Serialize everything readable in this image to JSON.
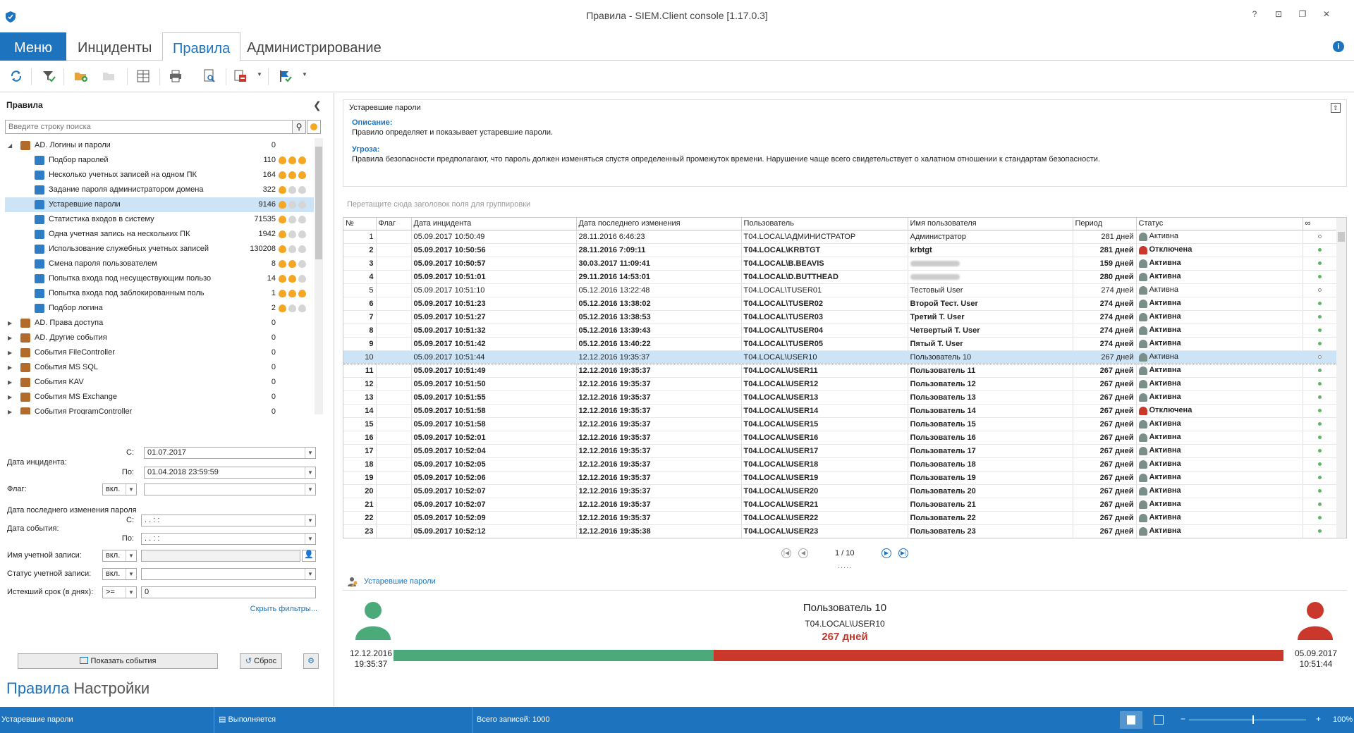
{
  "window": {
    "title": "Правила - SIEM.Client console [1.17.0.3]",
    "controls": [
      "?",
      "⊡",
      "❐",
      "✕"
    ]
  },
  "menu": {
    "tabs": [
      "Меню",
      "Инциденты",
      "Правила",
      "Администрирование"
    ],
    "active": 2,
    "info": "i"
  },
  "colors": {
    "accent": "#1e73be",
    "selection": "#cde4f7",
    "active_green": "#4aaa79",
    "expired_red": "#c9382a"
  },
  "left": {
    "title": "Правила",
    "search_placeholder": "Введите строку поиска",
    "tree": [
      {
        "label": "AD. Логины и пароли",
        "count": "0",
        "level": 0,
        "expanded": true,
        "icon": "user-key-icon"
      },
      {
        "label": "Подбор паролей",
        "count": "110",
        "level": 1,
        "fire": 3,
        "icon": "key-grid-icon"
      },
      {
        "label": "Несколько учетных записей на одном ПК",
        "count": "164",
        "level": 1,
        "fire": 3,
        "icon": "monitor-icon"
      },
      {
        "label": "Задание пароля администратором домена",
        "count": "322",
        "level": 1,
        "fire": 1,
        "icon": "admin-icon"
      },
      {
        "label": "Устаревшие пароли",
        "count": "9146",
        "level": 1,
        "fire": 1,
        "icon": "key-user-icon",
        "selected": true
      },
      {
        "label": "Статистика входов в систему",
        "count": "71535",
        "level": 1,
        "fire": 1,
        "icon": "login-icon"
      },
      {
        "label": "Одна учетная запись на нескольких ПК",
        "count": "1942",
        "level": 1,
        "fire": 1,
        "icon": "multi-pc-icon"
      },
      {
        "label": "Использование служебных учетных записей",
        "count": "130208",
        "level": 1,
        "fire": 1,
        "icon": "service-icon"
      },
      {
        "label": "Смена пароля пользователем",
        "count": "8",
        "level": 1,
        "fire": 2,
        "icon": "password-change-icon"
      },
      {
        "label": "Попытка входа под несуществующим пользо",
        "count": "14",
        "level": 1,
        "fire": 2,
        "icon": "sun-user-icon"
      },
      {
        "label": "Попытка входа под заблокированным поль",
        "count": "1",
        "level": 1,
        "fire": 3,
        "icon": "blocked-user-icon"
      },
      {
        "label": "Подбор логина",
        "count": "2",
        "level": 1,
        "fire": 1,
        "icon": "login-guess-icon"
      },
      {
        "label": "AD. Права доступа",
        "count": "0",
        "level": 0,
        "icon": "access-icon"
      },
      {
        "label": "AD. Другие события",
        "count": "0",
        "level": 0,
        "icon": "ad-events-icon"
      },
      {
        "label": "События FileController",
        "count": "0",
        "level": 0,
        "icon": "file-icon"
      },
      {
        "label": "События MS SQL",
        "count": "0",
        "level": 0,
        "icon": "sql-icon"
      },
      {
        "label": "События KAV",
        "count": "0",
        "level": 0,
        "icon": "kav-icon"
      },
      {
        "label": "События MS Exchange",
        "count": "0",
        "level": 0,
        "icon": "exchange-icon"
      },
      {
        "label": "События ProgramController",
        "count": "0",
        "level": 0,
        "icon": "program-icon"
      }
    ],
    "filters": {
      "incident_date": "Дата инцидента:",
      "from": "С:",
      "to": "По:",
      "from_value": "01.07.2017",
      "to_value": "01.04.2018 23:59:59",
      "flag": "Флаг:",
      "flag_mode": "вкл.",
      "flag_value": "",
      "last_change": "Дата последнего изменения пароля",
      "event_date": "Дата события:",
      "event_from": " .  .     :  :",
      "event_to": " .  .     :  :",
      "account_name": "Имя учетной записи:",
      "account_mode": "вкл.",
      "account_value": "",
      "account_status": "Статус учетной записи:",
      "status_mode": "вкл.",
      "status_value": "",
      "expired": "Истекший срок (в днях):",
      "expired_op": ">=",
      "expired_value": "0",
      "hide": "Скрыть фильтры..."
    },
    "show_events": "Показать события",
    "reset": "Сброс",
    "bottom_tabs": [
      "Правила",
      "Настройки"
    ]
  },
  "rule": {
    "title": "Устаревшие пароли",
    "desc_label": "Описание:",
    "desc": "Правило определяет и показывает устаревшие пароли.",
    "threat_label": "Угроза:",
    "threat": "Правила безопасности предполагают, что пароль должен изменяться спустя определенный промежуток времени. Нарушение чаще всего свидетельствует о халатном отношении к стандартам безопасности.",
    "group_hint": "Перетащите сюда заголовок поля для группировки"
  },
  "grid": {
    "columns": [
      "№",
      "Флаг",
      "Дата инцидента",
      "Дата последнего изменения",
      "Пользователь",
      "Имя пользователя",
      "Период",
      "Статус",
      "∞"
    ],
    "rows": [
      {
        "n": "1",
        "inc": "05.09.2017 10:50:49",
        "chg": "28.11.2016 6:46:23",
        "user": "T04.LOCAL\\АДМИНИСТРАТОР",
        "name": "Администратор",
        "period": "281 дней",
        "status": "Активна",
        "b": false,
        "dot": "hollow"
      },
      {
        "n": "2",
        "inc": "05.09.2017 10:50:56",
        "chg": "28.11.2016 7:09:11",
        "user": "T04.LOCAL\\KRBTGT",
        "name": "krbtgt",
        "period": "281 дней",
        "status": "Отключена",
        "b": true,
        "dot": "green",
        "st": "off"
      },
      {
        "n": "3",
        "inc": "05.09.2017 10:50:57",
        "chg": "30.03.2017 11:09:41",
        "user": "T04.LOCAL\\B.BEAVIS",
        "name": "",
        "period": "159 дней",
        "status": "Активна",
        "b": true,
        "dot": "green",
        "blur": true
      },
      {
        "n": "4",
        "inc": "05.09.2017 10:51:01",
        "chg": "29.11.2016 14:53:01",
        "user": "T04.LOCAL\\D.BUTTHEAD",
        "name": "",
        "period": "280 дней",
        "status": "Активна",
        "b": true,
        "dot": "green",
        "blur": true
      },
      {
        "n": "5",
        "inc": "05.09.2017 10:51:10",
        "chg": "05.12.2016 13:22:48",
        "user": "T04.LOCAL\\TUSER01",
        "name": "Тестовый User",
        "period": "274 дней",
        "status": "Активна",
        "b": false,
        "dot": "hollow"
      },
      {
        "n": "6",
        "inc": "05.09.2017 10:51:23",
        "chg": "05.12.2016 13:38:02",
        "user": "T04.LOCAL\\TUSER02",
        "name": "Второй Тест. User",
        "period": "274 дней",
        "status": "Активна",
        "b": true,
        "dot": "green"
      },
      {
        "n": "7",
        "inc": "05.09.2017 10:51:27",
        "chg": "05.12.2016 13:38:53",
        "user": "T04.LOCAL\\TUSER03",
        "name": "Третий Т. User",
        "period": "274 дней",
        "status": "Активна",
        "b": true,
        "dot": "green"
      },
      {
        "n": "8",
        "inc": "05.09.2017 10:51:32",
        "chg": "05.12.2016 13:39:43",
        "user": "T04.LOCAL\\TUSER04",
        "name": "Четвертый Т. User",
        "period": "274 дней",
        "status": "Активна",
        "b": true,
        "dot": "green"
      },
      {
        "n": "9",
        "inc": "05.09.2017 10:51:42",
        "chg": "05.12.2016 13:40:22",
        "user": "T04.LOCAL\\TUSER05",
        "name": "Пятый Т. User",
        "period": "274 дней",
        "status": "Активна",
        "b": true,
        "dot": "green"
      },
      {
        "n": "10",
        "inc": "05.09.2017 10:51:44",
        "chg": "12.12.2016 19:35:37",
        "user": "T04.LOCAL\\USER10",
        "name": "Пользователь 10",
        "period": "267 дней",
        "status": "Активна",
        "b": false,
        "dot": "hollow",
        "sel": true
      },
      {
        "n": "11",
        "inc": "05.09.2017 10:51:49",
        "chg": "12.12.2016 19:35:37",
        "user": "T04.LOCAL\\USER11",
        "name": "Пользователь 11",
        "period": "267 дней",
        "status": "Активна",
        "b": true,
        "dot": "green"
      },
      {
        "n": "12",
        "inc": "05.09.2017 10:51:50",
        "chg": "12.12.2016 19:35:37",
        "user": "T04.LOCAL\\USER12",
        "name": "Пользователь 12",
        "period": "267 дней",
        "status": "Активна",
        "b": true,
        "dot": "green"
      },
      {
        "n": "13",
        "inc": "05.09.2017 10:51:55",
        "chg": "12.12.2016 19:35:37",
        "user": "T04.LOCAL\\USER13",
        "name": "Пользователь 13",
        "period": "267 дней",
        "status": "Активна",
        "b": true,
        "dot": "green"
      },
      {
        "n": "14",
        "inc": "05.09.2017 10:51:58",
        "chg": "12.12.2016 19:35:37",
        "user": "T04.LOCAL\\USER14",
        "name": "Пользователь 14",
        "period": "267 дней",
        "status": "Отключена",
        "b": true,
        "dot": "green",
        "st": "off"
      },
      {
        "n": "15",
        "inc": "05.09.2017 10:51:58",
        "chg": "12.12.2016 19:35:37",
        "user": "T04.LOCAL\\USER15",
        "name": "Пользователь 15",
        "period": "267 дней",
        "status": "Активна",
        "b": true,
        "dot": "green"
      },
      {
        "n": "16",
        "inc": "05.09.2017 10:52:01",
        "chg": "12.12.2016 19:35:37",
        "user": "T04.LOCAL\\USER16",
        "name": "Пользователь 16",
        "period": "267 дней",
        "status": "Активна",
        "b": true,
        "dot": "green"
      },
      {
        "n": "17",
        "inc": "05.09.2017 10:52:04",
        "chg": "12.12.2016 19:35:37",
        "user": "T04.LOCAL\\USER17",
        "name": "Пользователь 17",
        "period": "267 дней",
        "status": "Активна",
        "b": true,
        "dot": "green"
      },
      {
        "n": "18",
        "inc": "05.09.2017 10:52:05",
        "chg": "12.12.2016 19:35:37",
        "user": "T04.LOCAL\\USER18",
        "name": "Пользователь 18",
        "period": "267 дней",
        "status": "Активна",
        "b": true,
        "dot": "green"
      },
      {
        "n": "19",
        "inc": "05.09.2017 10:52:06",
        "chg": "12.12.2016 19:35:37",
        "user": "T04.LOCAL\\USER19",
        "name": "Пользователь 19",
        "period": "267 дней",
        "status": "Активна",
        "b": true,
        "dot": "green"
      },
      {
        "n": "20",
        "inc": "05.09.2017 10:52:07",
        "chg": "12.12.2016 19:35:37",
        "user": "T04.LOCAL\\USER20",
        "name": "Пользователь 20",
        "period": "267 дней",
        "status": "Активна",
        "b": true,
        "dot": "green"
      },
      {
        "n": "21",
        "inc": "05.09.2017 10:52:07",
        "chg": "12.12.2016 19:35:37",
        "user": "T04.LOCAL\\USER21",
        "name": "Пользователь 21",
        "period": "267 дней",
        "status": "Активна",
        "b": true,
        "dot": "green"
      },
      {
        "n": "22",
        "inc": "05.09.2017 10:52:09",
        "chg": "12.12.2016 19:35:37",
        "user": "T04.LOCAL\\USER22",
        "name": "Пользователь 22",
        "period": "267 дней",
        "status": "Активна",
        "b": true,
        "dot": "green"
      },
      {
        "n": "23",
        "inc": "05.09.2017 10:52:12",
        "chg": "12.12.2016 19:35:38",
        "user": "T04.LOCAL\\USER23",
        "name": "Пользователь 23",
        "period": "267 дней",
        "status": "Активна",
        "b": true,
        "dot": "green"
      }
    ]
  },
  "pager": {
    "text": "1 / 10"
  },
  "detail": {
    "header": "Устаревшие пароли",
    "user_name": "Пользователь 10",
    "login": "T04.LOCAL\\USER10",
    "days": "267 дней",
    "start_date": "12.12.2016",
    "start_time": "19:35:37",
    "end_date": "05.09.2017",
    "end_time": "10:51:44",
    "green_fraction": 0.36
  },
  "status": {
    "rule": "Устаревшие пароли",
    "state": "Выполняется",
    "total": "Всего записей: 1000",
    "zoom": "100%",
    "minus": "−",
    "plus": "+"
  }
}
